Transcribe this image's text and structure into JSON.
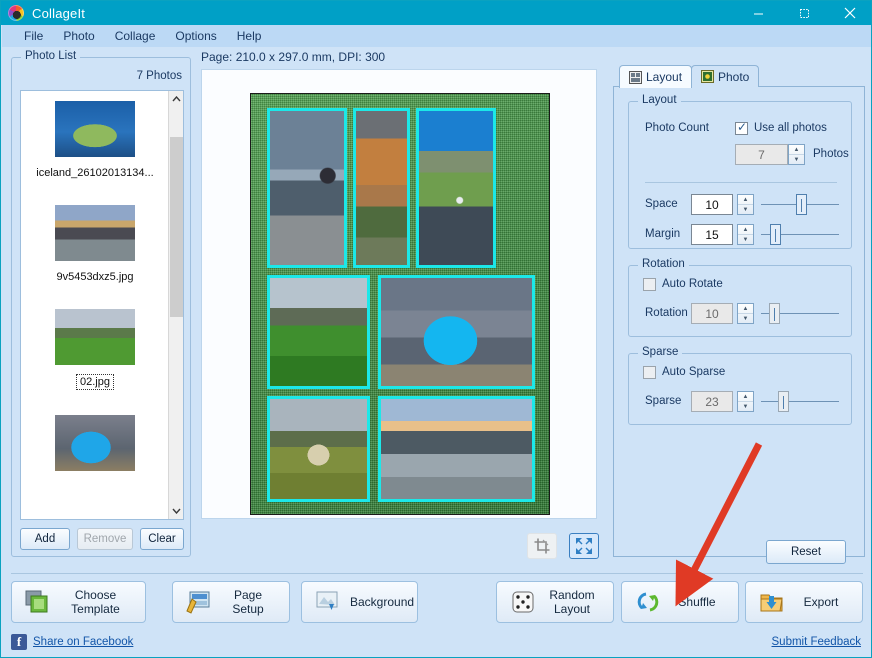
{
  "window": {
    "title": "CollageIt",
    "logo_icon": "collageit-logo-icon",
    "minimize_icon": "minimize-icon",
    "maximize_icon": "maximize-icon",
    "close_icon": "close-icon",
    "titlebar_color": "#00a0c6"
  },
  "menu": {
    "items": [
      {
        "label": "File"
      },
      {
        "label": "Photo"
      },
      {
        "label": "Collage"
      },
      {
        "label": "Options"
      },
      {
        "label": "Help"
      }
    ]
  },
  "photo_list": {
    "group_title": "Photo List",
    "count_label": "7 Photos",
    "items": [
      {
        "caption": "iceland_26102013134...",
        "selected": false
      },
      {
        "caption": "9v5453dxz5.jpg",
        "selected": false
      },
      {
        "caption": "02.jpg",
        "selected": true
      },
      {
        "caption": "",
        "selected": false
      }
    ],
    "scrollbar": {
      "up_arrow_icon": "chevron-up-icon",
      "down_arrow_icon": "chevron-down-icon"
    },
    "buttons": [
      {
        "label": "Add",
        "enabled": true
      },
      {
        "label": "Remove",
        "enabled": false
      },
      {
        "label": "Clear",
        "enabled": true
      }
    ]
  },
  "preview": {
    "page_info": "Page: 210.0 x 297.0 mm, DPI: 300",
    "page_width_mm": "210.0",
    "page_height_mm": "297.0",
    "dpi": "300",
    "cell_border_color": "#1ce8e8",
    "background_color": "#3d8b3d",
    "tools": [
      {
        "name": "crop-tool",
        "selected": false
      },
      {
        "name": "fit-tool",
        "selected": true
      }
    ]
  },
  "right_panel": {
    "tabs": [
      {
        "label": "Layout",
        "icon": "layout-icon",
        "active": true
      },
      {
        "label": "Photo",
        "icon": "photo-icon",
        "active": false
      }
    ],
    "layout_group": {
      "title": "Layout",
      "photo_count_label": "Photo Count",
      "use_all_photos_label": "Use all photos",
      "use_all_photos_checked": true,
      "photo_count_value": "7",
      "photos_suffix": "Photos",
      "space_label": "Space",
      "space_value": "10",
      "space_slider_percent": 52,
      "margin_label": "Margin",
      "margin_value": "15",
      "margin_slider_percent": 14
    },
    "rotation_group": {
      "title": "Rotation",
      "auto_label": "Auto Rotate",
      "auto_checked": false,
      "value_label": "Rotation",
      "value": "10",
      "slider_percent": 12
    },
    "sparse_group": {
      "title": "Sparse",
      "auto_label": "Auto Sparse",
      "auto_checked": false,
      "value_label": "Sparse",
      "value": "23",
      "slider_percent": 25
    },
    "reset_label": "Reset"
  },
  "bottom_bar": {
    "buttons": [
      {
        "label": "Choose Template",
        "icon": "template-icon"
      },
      {
        "label": "Page Setup",
        "icon": "page-setup-icon"
      },
      {
        "label": "Background",
        "icon": "background-icon"
      },
      {
        "label": "Random Layout",
        "icon": "dice-icon"
      },
      {
        "label": "Shuffle",
        "icon": "shuffle-icon"
      },
      {
        "label": "Export",
        "icon": "export-icon"
      }
    ],
    "facebook_link": "Share on Facebook",
    "facebook_icon": "facebook-icon",
    "feedback_link": "Submit Feedback"
  },
  "annotation": {
    "arrow_color": "#e03a25",
    "points_to": "Shuffle"
  }
}
